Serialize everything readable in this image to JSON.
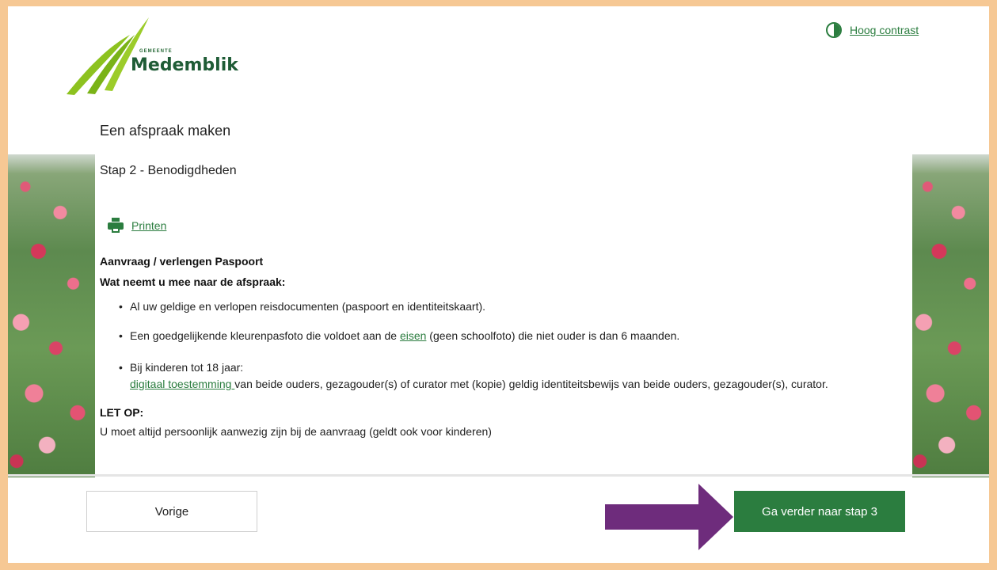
{
  "header": {
    "logo_small": "GEMEENTE",
    "logo_name": "Medemblik",
    "contrast_label": "Hoog contrast"
  },
  "page": {
    "title": "Een afspraak maken",
    "step": "Stap 2 - Benodigdheden",
    "print_label": "Printen"
  },
  "section": {
    "heading": "Aanvraag / verlengen Paspoort",
    "subheading": "Wat neemt u mee naar de afspraak:",
    "items": [
      {
        "text": "Al uw geldige en verlopen reisdocumenten (paspoort en identiteitskaart)."
      },
      {
        "before": "Een goedgelijkende kleurenpasfoto die voldoet aan de ",
        "link": "eisen",
        "after": " (geen schoolfoto) die niet ouder is dan 6 maanden."
      },
      {
        "line1": "Bij kinderen tot 18 jaar:",
        "link": "digitaal toestemming ",
        "after": "van beide ouders, gezagouder(s) of curator met (kopie) geldig identiteitsbewijs van beide ouders, gezagouder(s), curator."
      }
    ],
    "note_heading": "LET OP:",
    "note_text": "U moet altijd persoonlijk aanwezig zijn bij de aanvraag (geldt ook voor kinderen)"
  },
  "nav": {
    "prev_label": "Vorige",
    "next_label": "Ga verder naar stap 3"
  },
  "colors": {
    "accent": "#2b7d3f",
    "frame": "#f6c894",
    "arrow": "#6e2c7c"
  }
}
